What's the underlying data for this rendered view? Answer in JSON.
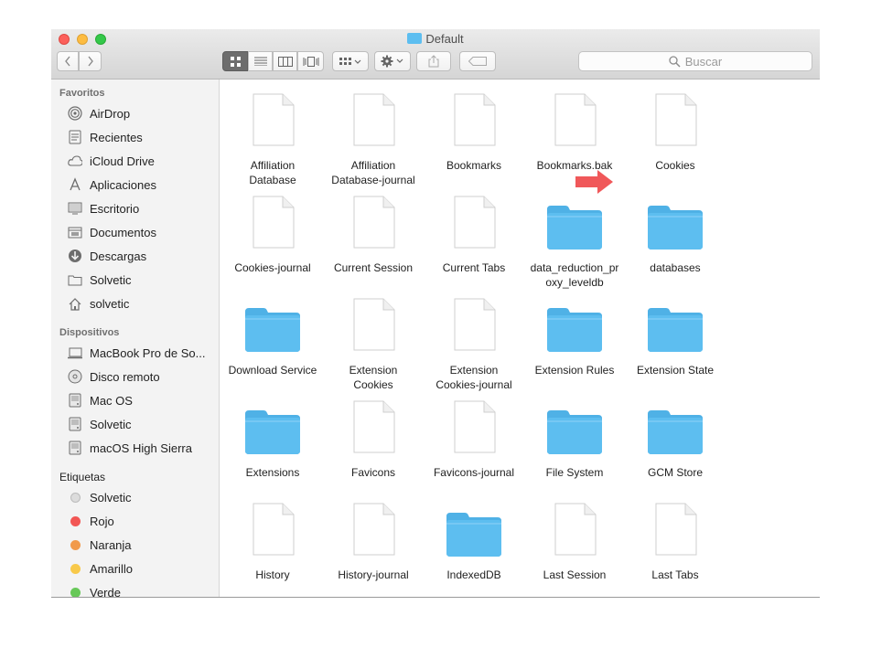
{
  "window": {
    "title": "Default"
  },
  "toolbar": {
    "back_icon": "chevron-left-icon",
    "forward_icon": "chevron-right-icon",
    "view_modes": [
      "icon-view-icon",
      "list-view-icon",
      "column-view-icon",
      "gallery-view-icon"
    ],
    "active_view": "icon-view-icon",
    "group_icon": "group-by-icon",
    "action_icon": "gear-icon",
    "share_icon": "share-icon",
    "tag_icon": "tag-icon",
    "search_placeholder": "Buscar"
  },
  "sidebar": {
    "favorites_title": "Favoritos",
    "favorites": [
      {
        "label": "AirDrop",
        "icon": "airdrop-icon"
      },
      {
        "label": "Recientes",
        "icon": "recents-icon"
      },
      {
        "label": "iCloud Drive",
        "icon": "cloud-icon"
      },
      {
        "label": "Aplicaciones",
        "icon": "applications-icon"
      },
      {
        "label": "Escritorio",
        "icon": "desktop-icon"
      },
      {
        "label": "Documentos",
        "icon": "documents-icon"
      },
      {
        "label": "Descargas",
        "icon": "downloads-icon"
      },
      {
        "label": "Solvetic",
        "icon": "folder-icon"
      },
      {
        "label": "solvetic",
        "icon": "home-icon"
      }
    ],
    "devices_title": "Dispositivos",
    "devices": [
      {
        "label": "MacBook Pro de So...",
        "icon": "laptop-icon"
      },
      {
        "label": "Disco remoto",
        "icon": "disc-icon"
      },
      {
        "label": "Mac OS",
        "icon": "drive-icon"
      },
      {
        "label": "Solvetic",
        "icon": "drive-icon"
      },
      {
        "label": "macOS High Sierra",
        "icon": "drive-icon"
      }
    ],
    "tags_title": "Etiquetas",
    "tags": [
      {
        "label": "Solvetic",
        "color": "#dcdcdc"
      },
      {
        "label": "Rojo",
        "color": "#f25654"
      },
      {
        "label": "Naranja",
        "color": "#f19a4c"
      },
      {
        "label": "Amarillo",
        "color": "#f8c94a"
      },
      {
        "label": "Verde",
        "color": "#67c858"
      }
    ]
  },
  "files": [
    {
      "name": "Affiliation\nDatabase",
      "type": "file"
    },
    {
      "name": "Affiliation\nDatabase-journal",
      "type": "file"
    },
    {
      "name": "Bookmarks",
      "type": "file"
    },
    {
      "name": "Bookmarks.bak",
      "type": "file"
    },
    {
      "name": "Cookies",
      "type": "file"
    },
    {
      "name": "Cookies-journal",
      "type": "file"
    },
    {
      "name": "Current Session",
      "type": "file"
    },
    {
      "name": "Current Tabs",
      "type": "file"
    },
    {
      "name": "data_reduction_pr\noxy_leveldb",
      "type": "folder"
    },
    {
      "name": "databases",
      "type": "folder"
    },
    {
      "name": "Download Service",
      "type": "folder"
    },
    {
      "name": "Extension\nCookies",
      "type": "file"
    },
    {
      "name": "Extension\nCookies-journal",
      "type": "file"
    },
    {
      "name": "Extension Rules",
      "type": "folder"
    },
    {
      "name": "Extension State",
      "type": "folder"
    },
    {
      "name": "Extensions",
      "type": "folder"
    },
    {
      "name": "Favicons",
      "type": "file"
    },
    {
      "name": "Favicons-journal",
      "type": "file"
    },
    {
      "name": "File System",
      "type": "folder"
    },
    {
      "name": "GCM Store",
      "type": "folder"
    },
    {
      "name": "History",
      "type": "file"
    },
    {
      "name": "History-journal",
      "type": "file"
    },
    {
      "name": "IndexedDB",
      "type": "folder"
    },
    {
      "name": "Last Session",
      "type": "file"
    },
    {
      "name": "Last Tabs",
      "type": "file"
    }
  ],
  "highlight": {
    "target": "Bookmarks",
    "color": "#f0585a"
  },
  "colors": {
    "folder": "#5dbef0",
    "folder_tab": "#4fb1e6"
  }
}
